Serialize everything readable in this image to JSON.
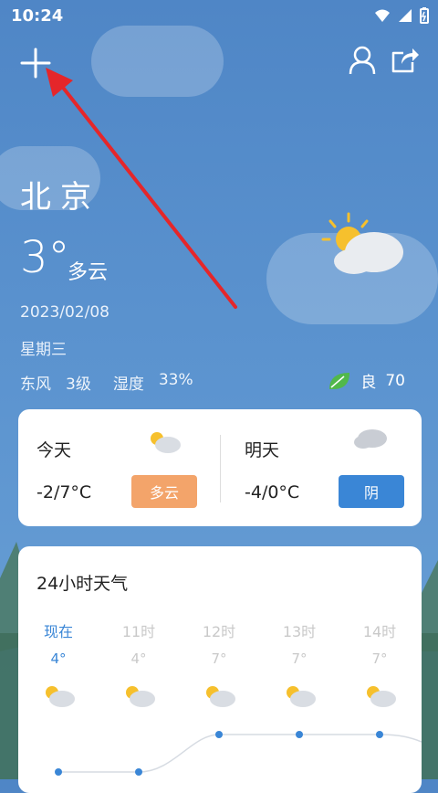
{
  "status": {
    "time": "10:24"
  },
  "location": {
    "city": "北京"
  },
  "current": {
    "temp": "3°",
    "desc": "多云",
    "date": "2023/02/08",
    "weekday": "星期三"
  },
  "details": {
    "wind_dir": "东风",
    "wind_level": "3级",
    "humidity_label": "湿度",
    "humidity_value": "33%"
  },
  "aqi": {
    "label": "良",
    "value": "70"
  },
  "today": {
    "label": "今天",
    "temp": "-2/7°C",
    "condition": "多云"
  },
  "tomorrow": {
    "label": "明天",
    "temp": "-4/0°C",
    "condition": "阴"
  },
  "hourly": {
    "title": "24小时天气",
    "items": [
      {
        "label": "现在",
        "temp": "4°"
      },
      {
        "label": "11时",
        "temp": "4°"
      },
      {
        "label": "12时",
        "temp": "7°"
      },
      {
        "label": "13时",
        "temp": "7°"
      },
      {
        "label": "14时",
        "temp": "7°"
      }
    ]
  },
  "colors": {
    "accent": "#3a86d6",
    "pill_cloudy": "#f3a46a",
    "pill_overcast": "#3a86d6",
    "leaf": "#51b84b",
    "arrow": "#e5262a"
  },
  "icons": {
    "plus": "plus-icon",
    "user": "user-icon",
    "share": "share-icon",
    "leaf": "leaf-icon"
  }
}
